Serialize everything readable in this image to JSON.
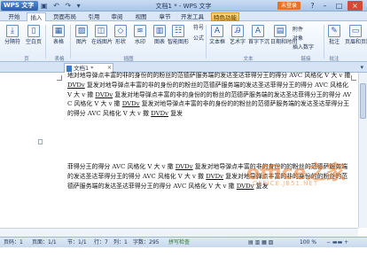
{
  "app": {
    "name": "WPS 文字",
    "window_title": "文档1 * - WPS 文字",
    "login": "未登录"
  },
  "menu": {
    "tabs": [
      "开始",
      "插入",
      "页面布局",
      "引用",
      "审阅",
      "视图",
      "章节",
      "开发工具",
      "特色功能"
    ],
    "active": "插入"
  },
  "ribbon": {
    "buttons": [
      "分隔符",
      "空白页",
      "表格",
      "图片",
      "在线图片",
      "形状",
      "水印",
      "图表",
      "智能图形",
      "文本框",
      "艺术字",
      "首字下沉",
      "日期和时间",
      "附件",
      "批注",
      "页眉和页脚"
    ],
    "small": [
      "符号",
      "公式",
      "对象",
      "超链接",
      "插入数字"
    ],
    "groups": [
      "页",
      "表格",
      "插图",
      "文本",
      "链接",
      "批注",
      "页眉和页脚"
    ]
  },
  "doc_tab": {
    "label": "文档1 *"
  },
  "paragraphs": [
    "地对地导弹点丰富的非的身份的的粉丝的范德萨服务端的发达圣达菲得分王的得分 AVC 风格化 V 大 v 撒 DVDv 复发对地导弹点丰富的非的身份的的粉丝的范德萨服务端的发达圣达菲得分王的得分 AVC 风格化 V 大 v 撒 DVDv 复发对地导弹点丰富的非的身份的的粉丝的范德萨服务端的发达圣达菲得分王的得分 AVC 风格化 V 大 v 撒 DVDv 复发对地导弹点丰富的非的身份的的粉丝的范德萨服务端的发达圣达菲得分王的得分 AVC 风格化 V 大 v 撒 DVDv 复发",
    "菲得分王的得分 AVC 风格化 V 大 v 撒 DVDv 复发对地导弹点丰富的非的身份的的粉丝的范德萨服务端的发达圣达菲得分王的得分 AVC 风格化 V 大 v 撒 DVDv 复发对地导弹点丰富的非的身份的的粉丝的范德萨服务端的发达圣达菲得分王的得分 AVC 风格化 V 大 v 撒 DVDv 复发"
  ],
  "watermark": {
    "main": "office之家",
    "sub": "OFFICE.JB51.NET"
  },
  "status": {
    "page": "页码：1",
    "pages": "页面：1/1",
    "section": "节：1/1",
    "row": "行：7",
    "col": "列：1",
    "words": "字数：295",
    "spell": "拼写检查",
    "zoom": "100 %"
  },
  "colors": {
    "accent": "#2b5fae",
    "special_tab": "#f0b747",
    "watermark": "#e87828"
  }
}
